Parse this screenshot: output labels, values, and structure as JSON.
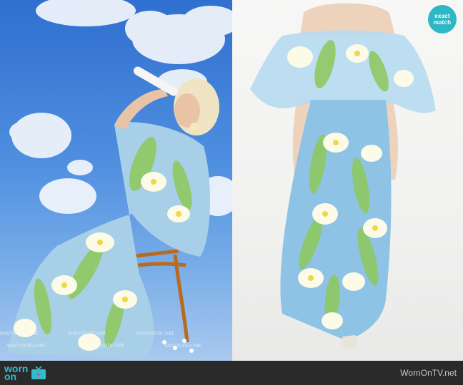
{
  "badge": {
    "line1": "exact",
    "line2": "match"
  },
  "watermark": {
    "text": "wornontv.net"
  },
  "footer": {
    "logo_line1": "worn",
    "logo_line2": "on",
    "logo_icon": "tv-icon",
    "site_name": "WornOnTV.net"
  },
  "colors": {
    "accent": "#2eb8c6",
    "footer_bg": "#2a2a2a",
    "sky": "#4f8fe0",
    "dress_blue": "#8fc3e6",
    "dress_green": "#8dc85a"
  }
}
